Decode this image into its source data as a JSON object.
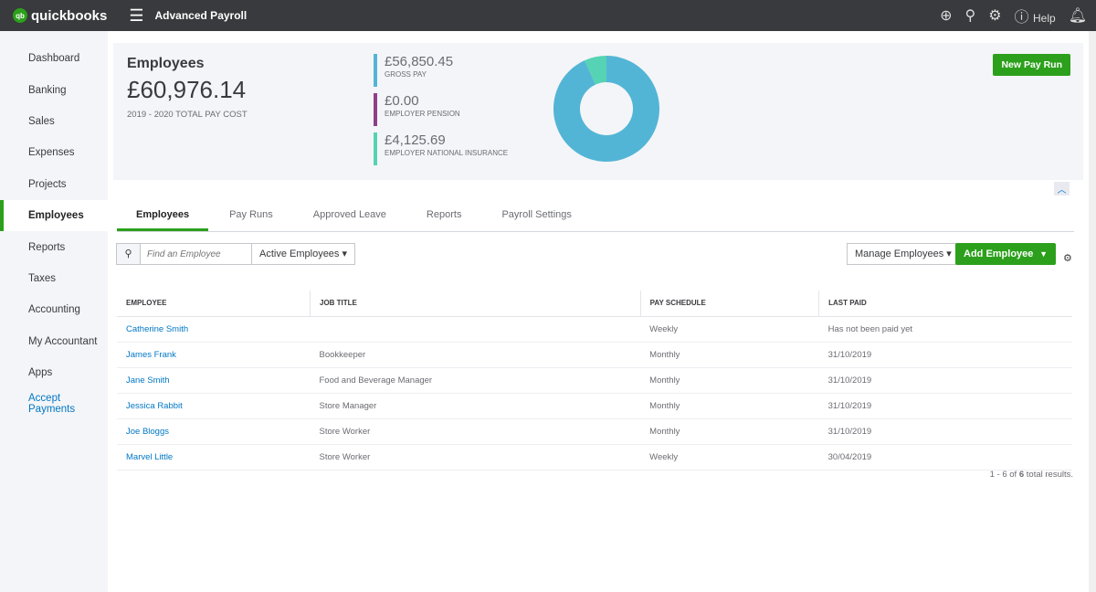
{
  "topbar": {
    "logo_text": "quickbooks",
    "logo_small": "intuit",
    "app_title": "Advanced Payroll",
    "help": "Help"
  },
  "sidebar": {
    "items": [
      {
        "label": "Dashboard"
      },
      {
        "label": "Banking"
      },
      {
        "label": "Sales"
      },
      {
        "label": "Expenses"
      },
      {
        "label": "Projects"
      },
      {
        "label": "Employees",
        "active": true
      },
      {
        "label": "Reports"
      },
      {
        "label": "Taxes"
      },
      {
        "label": "Accounting"
      },
      {
        "label": "My Accountant"
      },
      {
        "label": "Apps"
      },
      {
        "label": "Accept Payments",
        "link": true
      }
    ]
  },
  "summary": {
    "title": "Employees",
    "total": "£60,976.14",
    "total_label": "2019 - 2020 TOTAL PAY COST",
    "metrics": [
      {
        "value": "£56,850.45",
        "label": "GROSS PAY",
        "color": "#53b5d6"
      },
      {
        "value": "£0.00",
        "label": "EMPLOYER PENSION",
        "color": "#8d3f8c"
      },
      {
        "value": "£4,125.69",
        "label": "EMPLOYER NATIONAL INSURANCE",
        "color": "#55d3b4"
      }
    ],
    "new_pay_run": "New Pay Run"
  },
  "tabs": [
    {
      "label": "Employees",
      "active": true
    },
    {
      "label": "Pay Runs"
    },
    {
      "label": "Approved Leave"
    },
    {
      "label": "Reports"
    },
    {
      "label": "Payroll Settings"
    }
  ],
  "toolbar": {
    "search_placeholder": "Find an Employee",
    "filter": "Active Employees",
    "manage": "Manage Employees",
    "add": "Add Employee"
  },
  "table": {
    "headers": [
      "EMPLOYEE",
      "JOB TITLE",
      "PAY SCHEDULE",
      "LAST PAID"
    ],
    "rows": [
      [
        "Catherine Smith",
        "",
        "Weekly",
        "Has not been paid yet"
      ],
      [
        "James Frank",
        "Bookkeeper",
        "Monthly",
        "31/10/2019"
      ],
      [
        "Jane Smith",
        "Food and Beverage Manager",
        "Monthly",
        "31/10/2019"
      ],
      [
        "Jessica Rabbit",
        "Store Manager",
        "Monthly",
        "31/10/2019"
      ],
      [
        "Joe Bloggs",
        "Store Worker",
        "Monthly",
        "31/10/2019"
      ],
      [
        "Marvel Little",
        "Store Worker",
        "Weekly",
        "30/04/2019"
      ]
    ]
  },
  "results": {
    "prefix": "1 - 6 of",
    "count": "6",
    "suffix": "total results."
  }
}
